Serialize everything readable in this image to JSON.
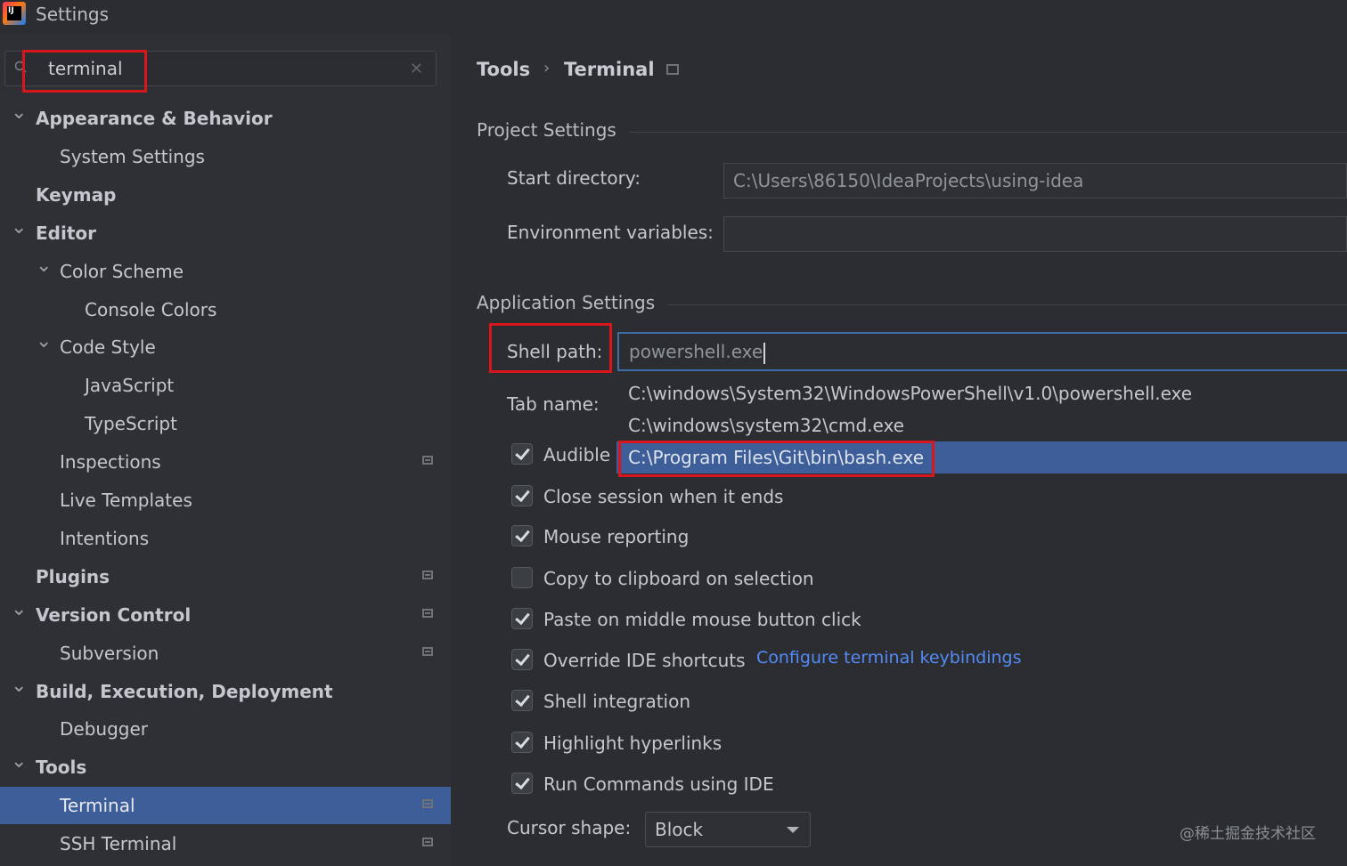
{
  "window": {
    "title": "Settings",
    "app_icon": "intellij-idea-icon"
  },
  "search": {
    "value": "terminal",
    "icon": "search-icon",
    "clear_icon": "close-icon"
  },
  "tree": [
    {
      "label": "Appearance & Behavior",
      "bold": true,
      "expanded": true,
      "level": 0
    },
    {
      "label": "System Settings",
      "level": 1
    },
    {
      "label": "Keymap",
      "bold": true,
      "level": 0
    },
    {
      "label": "Editor",
      "bold": true,
      "expanded": true,
      "level": 0
    },
    {
      "label": "Color Scheme",
      "expanded": true,
      "level": 1
    },
    {
      "label": "Console Colors",
      "level": 2
    },
    {
      "label": "Code Style",
      "expanded": true,
      "level": 1
    },
    {
      "label": "JavaScript",
      "level": 2
    },
    {
      "label": "TypeScript",
      "level": 2
    },
    {
      "label": "Inspections",
      "level": 1,
      "project_icon": true
    },
    {
      "label": "Live Templates",
      "level": 1
    },
    {
      "label": "Intentions",
      "level": 1
    },
    {
      "label": "Plugins",
      "bold": true,
      "level": 0,
      "project_icon": true
    },
    {
      "label": "Version Control",
      "bold": true,
      "expanded": true,
      "level": 0,
      "project_icon": true
    },
    {
      "label": "Subversion",
      "level": 1,
      "project_icon": true
    },
    {
      "label": "Build, Execution, Deployment",
      "bold": true,
      "expanded": true,
      "level": 0
    },
    {
      "label": "Debugger",
      "level": 1
    },
    {
      "label": "Tools",
      "bold": true,
      "expanded": true,
      "level": 0
    },
    {
      "label": "Terminal",
      "level": 1,
      "selected": true,
      "project_icon": true
    },
    {
      "label": "SSH Terminal",
      "level": 1,
      "project_icon": true
    }
  ],
  "breadcrumb": {
    "parent": "Tools",
    "separator": "›",
    "current": "Terminal"
  },
  "project_settings": {
    "title": "Project Settings",
    "start_directory_label": "Start directory:",
    "start_directory_value": "C:\\Users\\86150\\IdeaProjects\\using-idea",
    "env_vars_label": "Environment variables:",
    "env_vars_value": ""
  },
  "application_settings": {
    "title": "Application Settings",
    "shell_path_label": "Shell path:",
    "shell_path_value": "powershell.exe",
    "shell_options": [
      "C:\\windows\\System32\\WindowsPowerShell\\v1.0\\powershell.exe",
      "C:\\windows\\system32\\cmd.exe",
      "C:\\Program Files\\Git\\bin\\bash.exe"
    ],
    "tab_name_label": "Tab name:",
    "checkboxes": [
      {
        "label": "Audible",
        "checked": true
      },
      {
        "label": "Close session when it ends",
        "checked": true
      },
      {
        "label": "Mouse reporting",
        "checked": true
      },
      {
        "label": "Copy to clipboard on selection",
        "checked": false
      },
      {
        "label": "Paste on middle mouse button click",
        "checked": true
      },
      {
        "label": "Override IDE shortcuts",
        "checked": true
      },
      {
        "label": "Shell integration",
        "checked": true
      },
      {
        "label": "Highlight hyperlinks",
        "checked": true
      },
      {
        "label": "Run Commands using IDE",
        "checked": true
      }
    ],
    "keybindings_link": "Configure terminal keybindings",
    "cursor_shape_label": "Cursor shape:",
    "cursor_shape_value": "Block"
  },
  "watermark": "@稀土掘金技术社区",
  "colors": {
    "selection": "#3d5e98",
    "highlight_box": "#d7161e",
    "link": "#548af7",
    "focus": "#3e6ea7"
  }
}
